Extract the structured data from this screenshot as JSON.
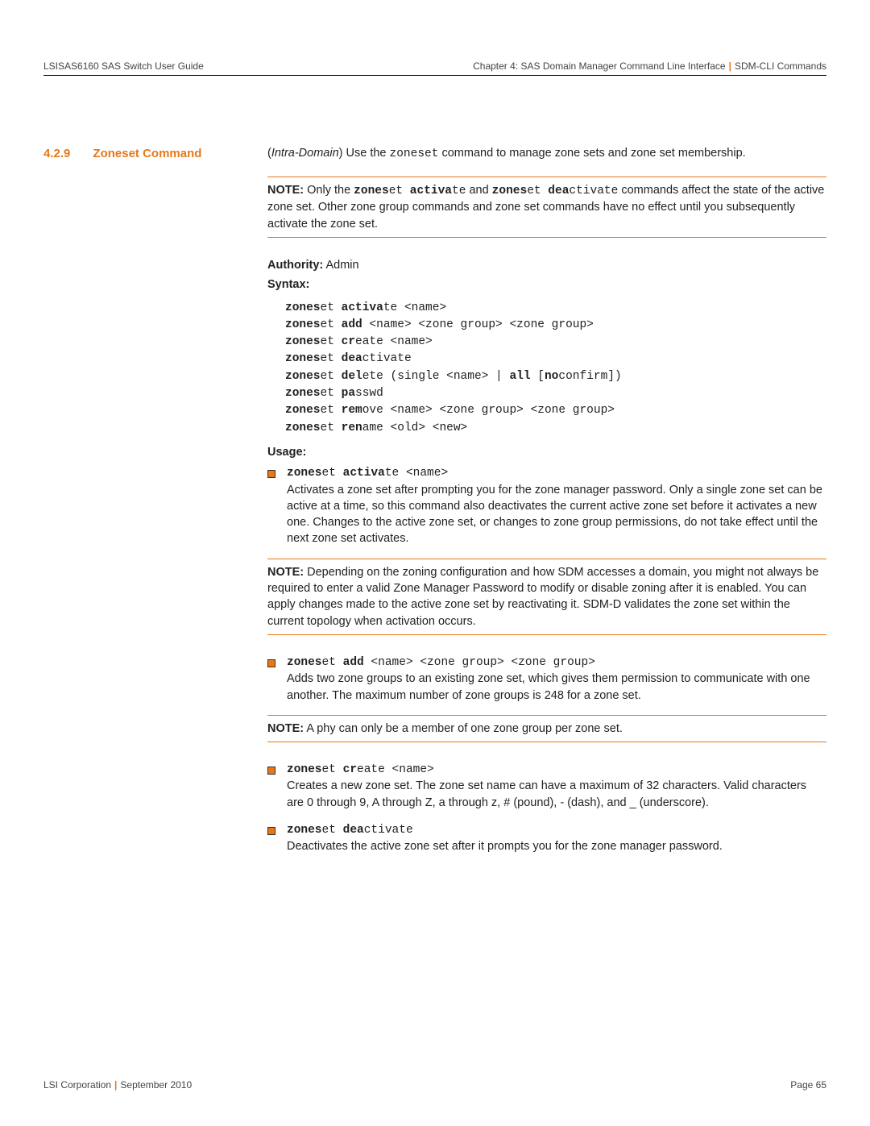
{
  "header": {
    "left": "LSISAS6160 SAS Switch User Guide",
    "right_a": "Chapter 4: SAS Domain Manager Command Line Interface",
    "right_b": "SDM-CLI Commands"
  },
  "section": {
    "num": "4.2.9",
    "title": "Zoneset Command"
  },
  "intro": {
    "intra": "Intra-Domain",
    "pre": ") Use the ",
    "cmd": "zoneset",
    "post": " command to manage zone sets and zone set membership."
  },
  "note1": {
    "label": "NOTE:",
    "t1": "  Only the ",
    "c1a": "zones",
    "c1b": "et ",
    "c1c": "activa",
    "c1d": "te",
    "t2": " and ",
    "c2a": "zones",
    "c2b": "et ",
    "c2c": "dea",
    "c2d": "ctivate",
    "t3": " commands affect the state of the active zone set. Other zone group commands and zone set commands have no effect until you subsequently activate the zone set."
  },
  "authority": {
    "label": "Authority:",
    "value": " Admin"
  },
  "syntax_label": "Syntax:",
  "syntax": {
    "l1": {
      "a": "zones",
      "b": "et ",
      "c": "activa",
      "d": "te <name>"
    },
    "l2": {
      "a": "zones",
      "b": "et ",
      "c": "add",
      "d": " <name> <zone group> <zone group>"
    },
    "l3": {
      "a": "zones",
      "b": "et ",
      "c": "cr",
      "d": "eate <name>"
    },
    "l4": {
      "a": "zones",
      "b": "et ",
      "c": "dea",
      "d": "ctivate"
    },
    "l5": {
      "a": "zones",
      "b": "et ",
      "c": "del",
      "d": "ete (single <name> | ",
      "e": "all",
      "f": " [",
      "g": "no",
      "h": "confirm])"
    },
    "l6": {
      "a": "zones",
      "b": "et ",
      "c": "pa",
      "d": "sswd"
    },
    "l7": {
      "a": "zones",
      "b": "et ",
      "c": "rem",
      "d": "ove <name> <zone group> <zone group>"
    },
    "l8": {
      "a": "zones",
      "b": "et ",
      "c": "ren",
      "d": "ame <old> <new>"
    }
  },
  "usage_label": "Usage:",
  "usage": {
    "u1": {
      "cmd_a": "zones",
      "cmd_b": "et ",
      "cmd_c": "activa",
      "cmd_d": "te <name>",
      "desc": "Activates a zone set after prompting you for the zone manager password. Only a single zone set can be active at a time, so this command also deactivates the current active zone set before it activates a new one. Changes to the active zone set, or changes to zone group permissions, do not take effect until the next zone set activates."
    },
    "u2": {
      "cmd_a": "zones",
      "cmd_b": "et ",
      "cmd_c": "add",
      "cmd_d": " <name> <zone group> <zone group>",
      "desc": "Adds two zone groups to an existing zone set, which gives them permission to communicate with one another. The maximum number of zone groups is 248 for a zone set."
    },
    "u3": {
      "cmd_a": "zones",
      "cmd_b": "et ",
      "cmd_c": "cr",
      "cmd_d": "eate <name>",
      "desc": "Creates a new zone set. The zone set name can have a maximum of 32 characters. Valid characters are 0 through 9, A through Z, a through z, # (pound), - (dash), and _ (underscore)."
    },
    "u4": {
      "cmd_a": "zones",
      "cmd_b": "et ",
      "cmd_c": "dea",
      "cmd_d": "ctivate",
      "desc": "Deactivates the active zone set after it prompts you for the zone manager password."
    }
  },
  "note2": {
    "label": "NOTE:",
    "text": "  Depending on the zoning configuration and how SDM accesses a domain, you might not always be required to enter a valid Zone Manager Password to modify or disable zoning after it is enabled. You can apply changes made to the active zone set by reactivating it. SDM-D validates the zone set within the current topology when activation occurs."
  },
  "note3": {
    "label": "NOTE:",
    "text": "  A phy can only be a member of one zone group per zone set."
  },
  "footer": {
    "left_a": "LSI Corporation",
    "left_b": "September 2010",
    "right": "Page 65"
  }
}
